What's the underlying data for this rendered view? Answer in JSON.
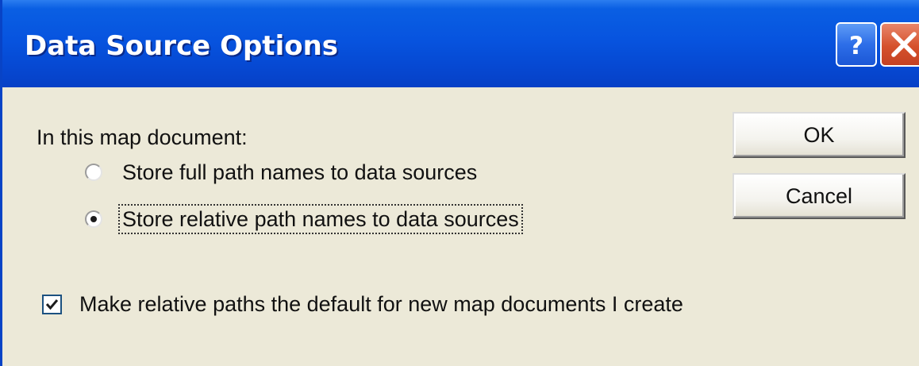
{
  "dialog": {
    "title": "Data Source Options",
    "help_button": "?",
    "close_button": "X"
  },
  "options": {
    "group_label": "In this map document:",
    "radio_full": {
      "label": "Store full path names to data sources",
      "selected": false
    },
    "radio_relative": {
      "label": "Store relative path names to data sources",
      "selected": true
    },
    "default_checkbox": {
      "label": "Make relative paths the default for new map documents I create",
      "checked": true
    }
  },
  "buttons": {
    "ok": "OK",
    "cancel": "Cancel"
  },
  "colors": {
    "titlebar": "#0754df",
    "dialog_face": "#ece9d8",
    "close": "#d5512c"
  },
  "icons": {
    "help": "question-mark-icon",
    "close": "close-x-icon",
    "check": "check-mark-icon"
  }
}
